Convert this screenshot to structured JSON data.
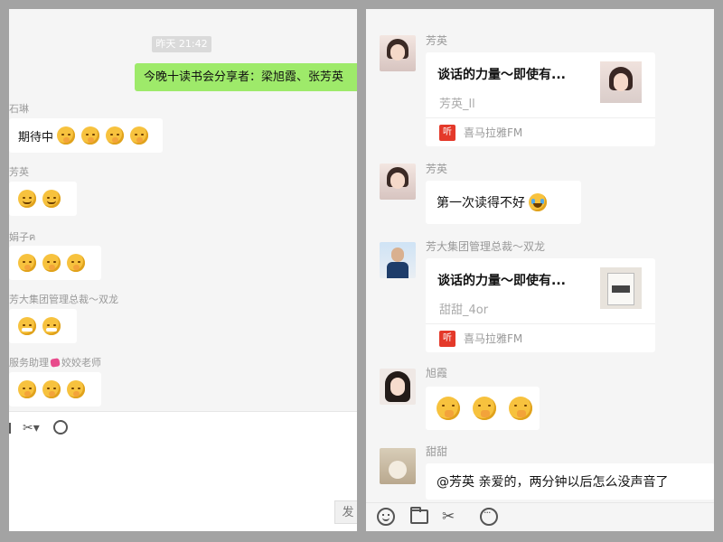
{
  "left": {
    "title": "",
    "timestamp": "昨天 21:42",
    "my_message": "今晚十读书会分享者：梁旭霞、张芳英",
    "messages": [
      {
        "sender": "石琳",
        "text": "期待中",
        "emojis": [
          "hand-over-mouth",
          "hand-over-mouth",
          "hand-over-mouth",
          "hand-over-mouth"
        ]
      },
      {
        "sender": "芳英",
        "text": "",
        "emojis": [
          "smile",
          "smile"
        ]
      },
      {
        "sender": "娟子ฅ",
        "text": "",
        "emojis": [
          "hand-over-mouth",
          "hand-over-mouth",
          "hand-over-mouth"
        ]
      },
      {
        "sender": "芳大集团管理总裁～双龙",
        "text": "",
        "emojis": [
          "money-mouth",
          "money-mouth"
        ]
      },
      {
        "sender_prefix": "服务助理",
        "sender_suffix": "姣姣老师",
        "text": "",
        "emojis": [
          "hand-over-mouth",
          "hand-over-mouth",
          "hand-over-mouth"
        ]
      }
    ],
    "send_label": "发"
  },
  "right": {
    "messages": [
      {
        "sender": "芳英",
        "type": "card",
        "card_title": "谈话的力量～即使有...",
        "card_subtitle": "芳英_ll",
        "source": "喜马拉雅FM",
        "logo_text": "听"
      },
      {
        "sender": "芳英",
        "type": "text",
        "text": "第一次读得不好",
        "emoji": "tears-of-joy"
      },
      {
        "sender": "芳大集团管理总裁～双龙",
        "type": "card",
        "card_title": "谈话的力量～即使有...",
        "card_subtitle": "甜甜_4or",
        "source": "喜马拉雅FM",
        "logo_text": "听"
      },
      {
        "sender": "旭霞",
        "type": "emoji",
        "emojis": [
          "hand-over-mouth",
          "hand-over-mouth",
          "hand-over-mouth"
        ]
      },
      {
        "sender": "甜甜",
        "type": "text",
        "text": "@芳英 亲爱的，两分钟以后怎么没声音了"
      }
    ]
  },
  "toolbar_icons": [
    "smile-icon",
    "folder-icon",
    "scissors-icon",
    "chat-history-icon"
  ]
}
